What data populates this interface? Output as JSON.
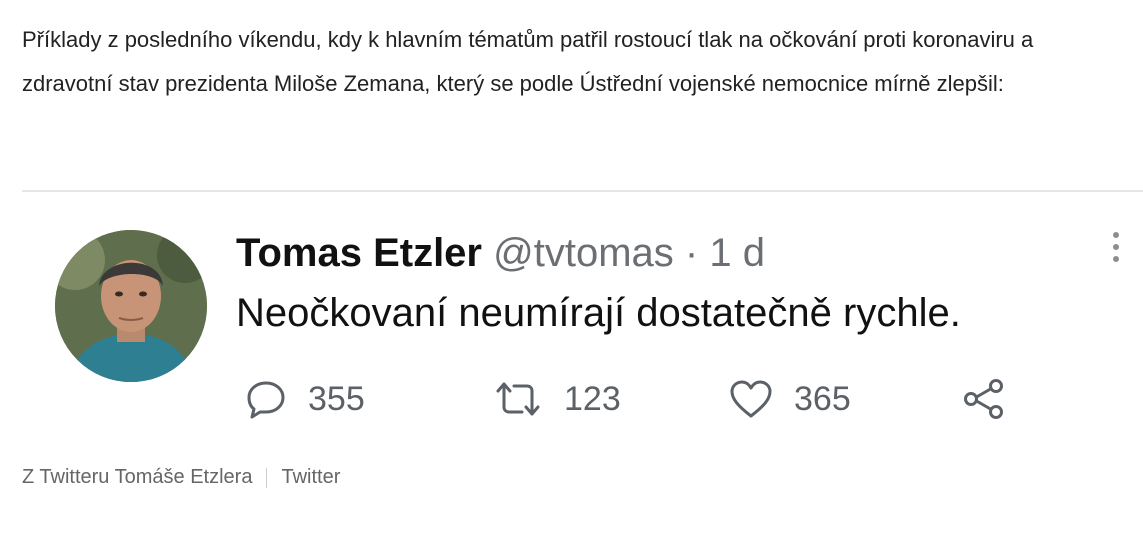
{
  "article": {
    "paragraph": "Příklady z posledního víkendu, kdy k hlavním tématům patřil rostoucí tlak na očkování proti koronaviru a zdravotní stav prezidenta Miloše Zemana, který se podle Ústřední vojenské nemocnice mírně zlepšil:"
  },
  "tweet": {
    "author_name": "Tomas Etzler",
    "handle": "@tvtomas",
    "separator": "·",
    "time": "1 d",
    "text": "Neočkovaní neumírají dostatečně rychle.",
    "more_icon": "more-vertical-icon",
    "actions": {
      "replies": {
        "icon": "reply-icon",
        "count": "355"
      },
      "retweets": {
        "icon": "retweet-icon",
        "count": "123"
      },
      "likes": {
        "icon": "heart-icon",
        "count": "365"
      },
      "share": {
        "icon": "share-icon"
      }
    }
  },
  "caption": {
    "source_text": "Z Twitteru Tomáše Etzlera",
    "link_text": "Twitter"
  },
  "colors": {
    "text": "#222222",
    "muted": "#6b6f73",
    "icon": "#5b6166",
    "divider": "#e6e6e6"
  }
}
